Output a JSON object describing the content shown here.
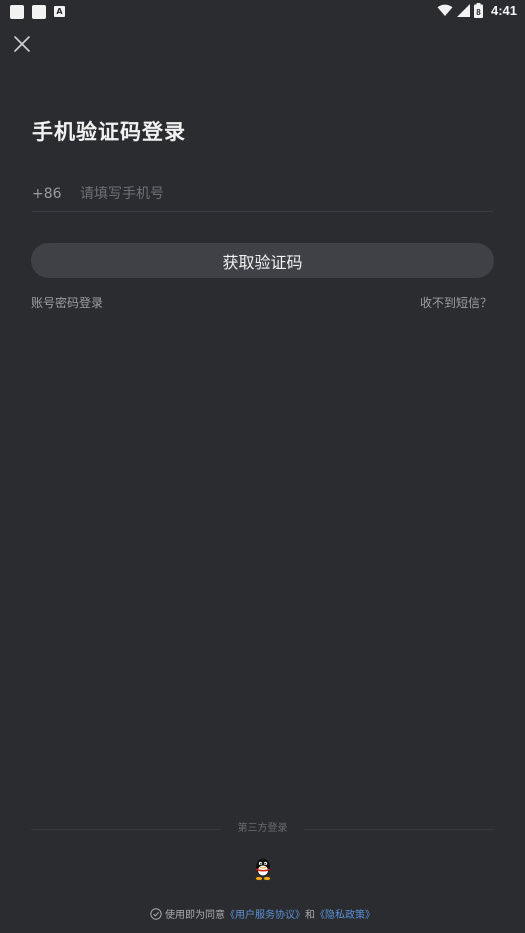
{
  "status_bar": {
    "time": "4:41",
    "battery_level": "8"
  },
  "page": {
    "title": "手机验证码登录",
    "country_code": "+86",
    "phone_placeholder": "请填写手机号",
    "get_code_button": "获取验证码",
    "password_login_link": "账号密码登录",
    "no_sms_link": "收不到短信？"
  },
  "third_party": {
    "label": "第三方登录",
    "providers": [
      "qq-icon"
    ]
  },
  "agreement": {
    "prefix": "使用即为同意",
    "service_link": "《用户服务协议》",
    "conjunction": "和",
    "privacy_link": "《隐私政策》"
  },
  "colors": {
    "background": "#2a2c30",
    "button": "#3f4146",
    "link_blue": "#5c8fd6"
  }
}
